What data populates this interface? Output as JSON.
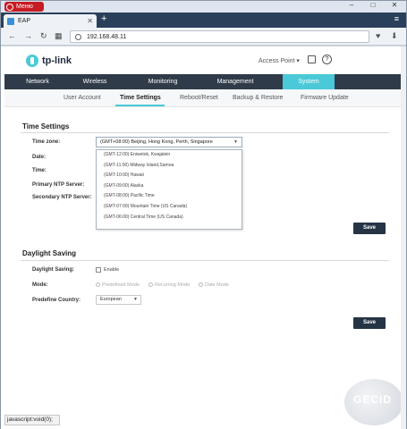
{
  "window": {
    "menu_label": "Меню",
    "tab_title": "EAP"
  },
  "address": {
    "url": "192.168.48.11"
  },
  "header": {
    "logo": "tp-link",
    "mode": "Access Point ▾"
  },
  "main_nav": [
    {
      "label": "Network"
    },
    {
      "label": "Wireless"
    },
    {
      "label": "Monitoring"
    },
    {
      "label": "Management"
    },
    {
      "label": "System"
    }
  ],
  "sub_nav": [
    {
      "label": "User Account"
    },
    {
      "label": "Time Settings"
    },
    {
      "label": "Reboot/Reset"
    },
    {
      "label": "Backup & Restore"
    },
    {
      "label": "Firmware Update"
    }
  ],
  "time_settings": {
    "title": "Time Settings",
    "time_zone_label": "Time zone:",
    "time_zone_value": "(GMT+08:00) Beijing, Hong Kong, Perth, Singapore",
    "date_label": "Date:",
    "time_label": "Time:",
    "primary_ntp_label": "Primary NTP Server:",
    "secondary_ntp_label": "Secondary NTP Server:",
    "options": [
      "(GMT-12:00) Eniwetok, Kwajalein",
      "(GMT-11:00) Midway Island,Samoa",
      "(GMT-10:00) Hawaii",
      "(GMT-09:00) Alaska",
      "(GMT-08:00) Pacific Time",
      "(GMT-07:00) Mountain Time (US Canada)",
      "(GMT-06:00) Central Time (US Canada)"
    ],
    "save": "Save"
  },
  "daylight": {
    "title": "Daylight Saving",
    "ds_label": "Daylight Saving:",
    "enable": "Enable",
    "mode_label": "Mode:",
    "modes": [
      "Predefined Mode",
      "Recurring Mode",
      "Date Mode"
    ],
    "country_label": "Predefine Country:",
    "country_value": "European",
    "save": "Save"
  },
  "status_bar": "javascript:void(0);",
  "watermark": "GECID"
}
